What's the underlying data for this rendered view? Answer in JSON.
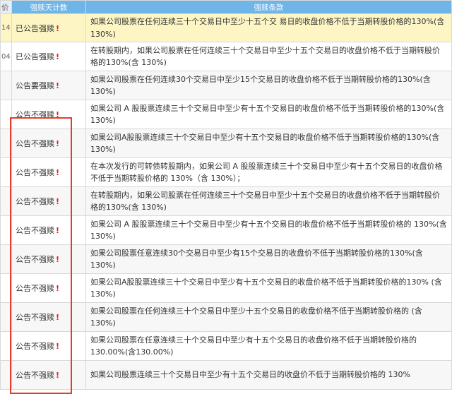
{
  "header": {
    "left": "价",
    "status": "强赎天计数",
    "terms": "强赎条款"
  },
  "rows": [
    {
      "left": "14",
      "status": "已公告强赎",
      "bang": "!",
      "terms": "如果公司股票在任何连续三十个交易日中至少十五个交 易日的收盘价格不低于当期转股价格的130%(含 130%)"
    },
    {
      "left": "04",
      "status": "已公告强赎",
      "bang": "!",
      "terms": "在转股期内，如果公司股票在任何连续三十个交易日中至少十五个交易日的收盘价格不低于当期转股价格的130%(含 130%)"
    },
    {
      "left": "",
      "status": "公告要强赎",
      "bang": "!",
      "terms": "如果公司股票在任何连续30个交易日中至少15个交易日的收盘价格不低于当期转股价格的130%(含 130%)"
    },
    {
      "left": "",
      "status": "公告不强赎",
      "bang": "!",
      "terms": "如果公司 A 股股票连续三十个交易日中至少有十五个交易日的收盘价格不低于当期转股价格的130%(含130%)"
    },
    {
      "left": "",
      "status": "公告不强赎",
      "bang": "!",
      "terms": "如果公司A股股票连续三十个交易日中至少有十五个交易日的收盘价格不低于当期转股价格的130%(含130%)"
    },
    {
      "left": "",
      "status": "公告不强赎",
      "bang": "!",
      "terms": "在本次发行的可转债转股期内，如果公司 A 股股票连续三十个交易日中至少有十五个交易日的收盘价格不低于当期转股价格的 130%（含 130%）；"
    },
    {
      "left": "",
      "status": "公告不强赎",
      "bang": "!",
      "terms": "在转股期内，如果公司股票在任何连续三十个交易日中至少十五个交易日的收盘价格不低于当期转股价格的130%(含 130%)"
    },
    {
      "left": "",
      "status": "公告不强赎",
      "bang": "!",
      "terms": "如果公司 A 股股票连续三十个交易日中至少有十五个交易日的收盘价格不低于当期转股价格的 130%(含 130%)"
    },
    {
      "left": "",
      "status": "公告不强赎",
      "bang": "!",
      "terms": "如果公司股票任意连续30个交易日中至少有15个交易日的收盘价不低于当期转股价格的130%(含 130%)"
    },
    {
      "left": "",
      "status": "公告不强赎",
      "bang": "!",
      "terms": "如果公司A股股票连续三十个交易日中至少有十五个交易日的收盘价格不低于当期转股价格的130% (含 130%)"
    },
    {
      "left": "",
      "status": "公告不强赎",
      "bang": "!",
      "terms": "如果公司股票在任何连续三十个交易日中至少十五个交易日的收盘价格不低于当期转股价格的 (含130%)"
    },
    {
      "left": "",
      "status": "公告不强赎",
      "bang": "!",
      "terms": "如果公司股票在任意连续三十个交易日中至少有十五个交易日的收盘价格不低于当期转股价格的130.00%(含130.00%)"
    },
    {
      "left": "",
      "status": "公告不强赎",
      "bang": "!",
      "terms": "如果公司股票连续三十个交易日中至少有十五个交易日的收盘价不低于当期转股价格的 130%"
    }
  ],
  "colors": {
    "header_bg": "#6fb5e8",
    "highlight_row": "#fdf6c4",
    "bang": "#e02020",
    "red_box": "#e53c2a"
  }
}
